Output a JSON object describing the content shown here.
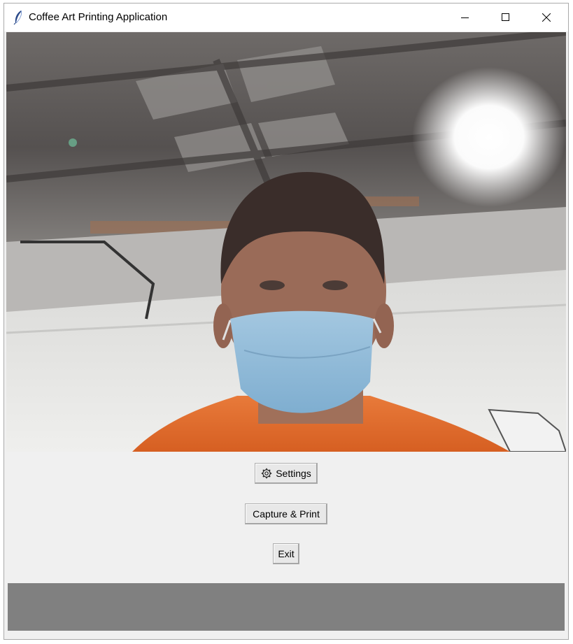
{
  "window": {
    "title": "Coffee Art Printing Application",
    "app_icon": "feather-icon",
    "controls": [
      "minimize-icon",
      "maximize-icon",
      "close-icon"
    ]
  },
  "video_feed": {
    "content": "camera-feed",
    "colors": {
      "shirt": "#e0692a",
      "mask": "#8fb8d6",
      "ceiling": "#5a5552",
      "wall": "#e6e6e4"
    }
  },
  "buttons": {
    "settings_label": "Settings",
    "settings_icon": "gear-icon",
    "capture_label": "Capture & Print",
    "exit_label": "Exit"
  },
  "status_bar": {
    "color": "#808080"
  }
}
